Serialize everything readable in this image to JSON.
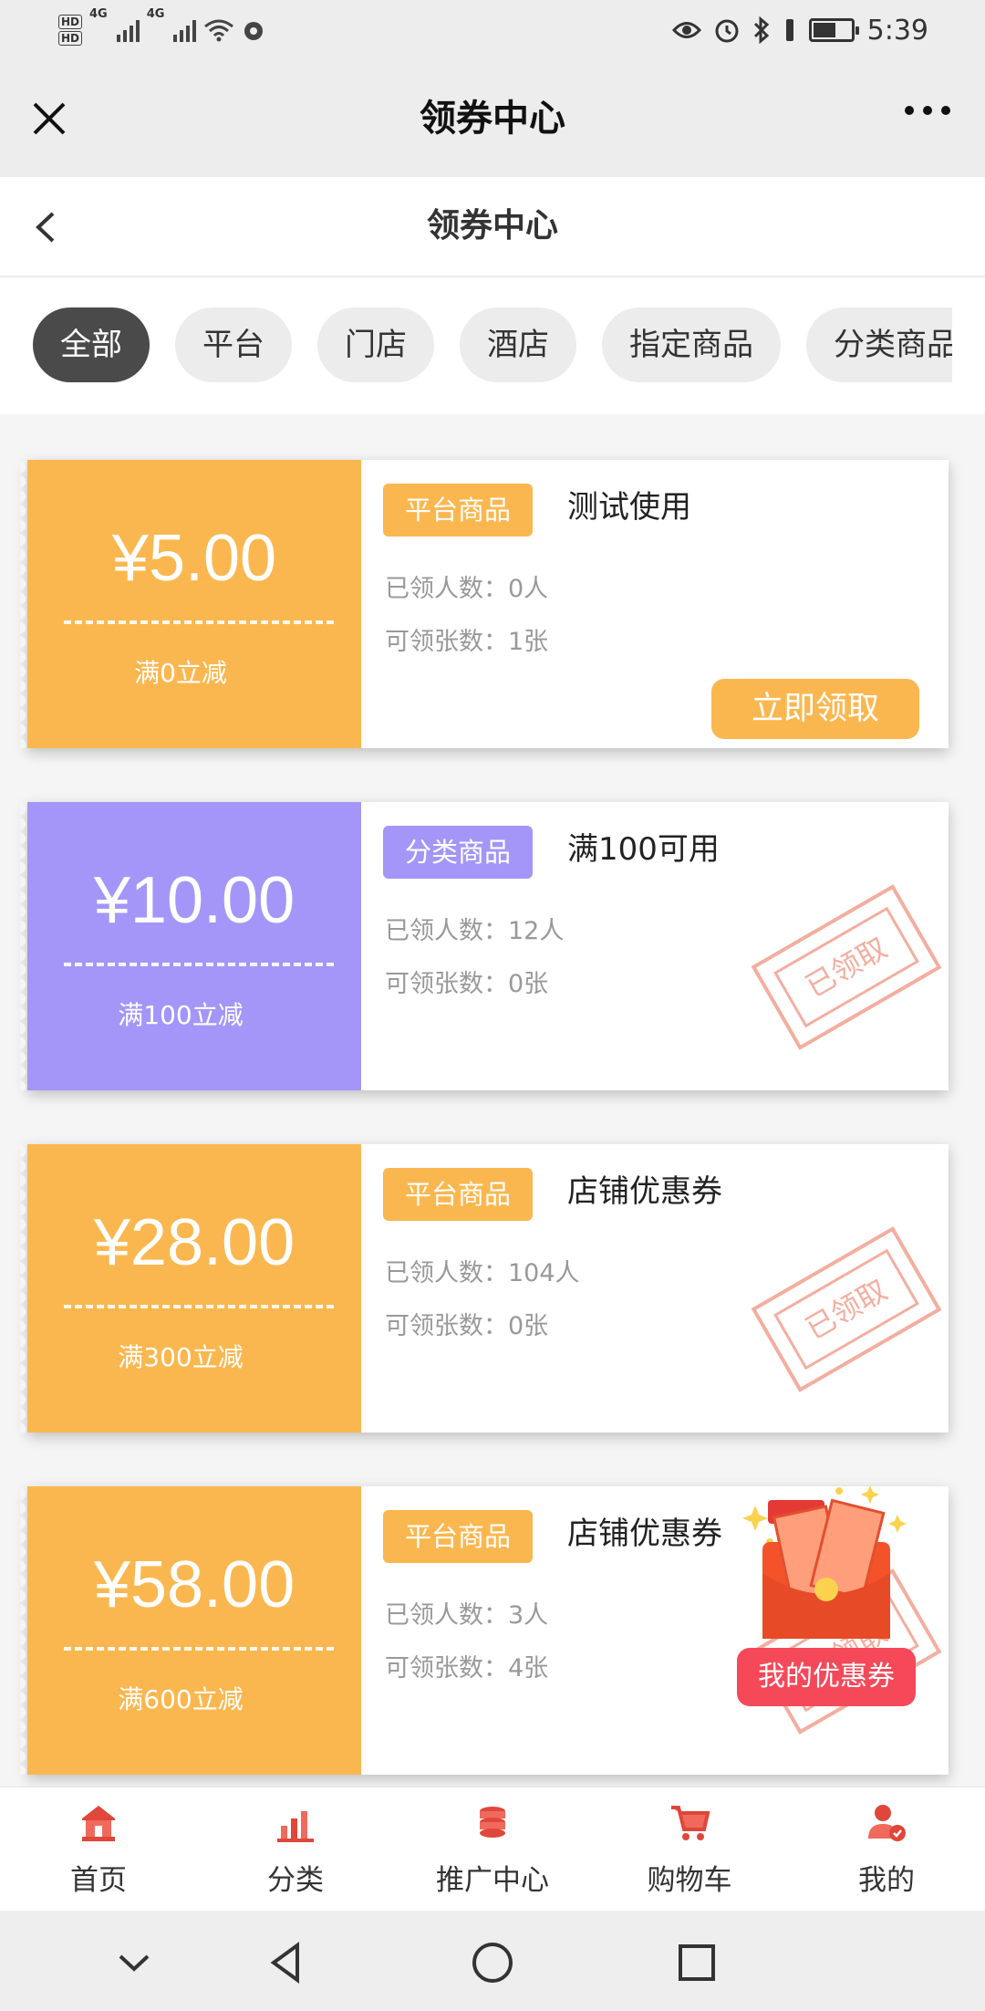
{
  "status_bar": {
    "hd_badges": [
      "HD",
      "HD"
    ],
    "signal_label_1": "4G",
    "signal_label_2": "4G",
    "time": "5:39",
    "icons": [
      "eye-icon",
      "alarm-icon",
      "bluetooth-icon",
      "vibrate-icon",
      "battery-icon"
    ]
  },
  "wechat_bar": {
    "title": "领券中心",
    "close_icon": "close-icon",
    "more_icon": "more-dots-icon"
  },
  "page_header": {
    "title": "领券中心",
    "back_icon": "back-chevron-icon"
  },
  "tabs": [
    "全部",
    "平台",
    "门店",
    "酒店",
    "指定商品",
    "分类商品"
  ],
  "active_tab_index": 0,
  "colors": {
    "orange": "#fbb74f",
    "purple": "#a496f8",
    "stamp": "#f1a08f",
    "badge": "#f5495a"
  },
  "coupons": [
    {
      "amount": "¥5.00",
      "condition": "满0立减",
      "tag": "平台商品",
      "name": "测试使用",
      "received": "已领人数：0人",
      "available": "可领张数：1张",
      "action": "立即领取",
      "theme": "orange"
    },
    {
      "amount": "¥10.00",
      "condition": "满100立减",
      "tag": "分类商品",
      "name": "满100可用",
      "received": "已领人数：12人",
      "available": "可领张数：0张",
      "stamp": "已领取",
      "theme": "purple"
    },
    {
      "amount": "¥28.00",
      "condition": "满300立减",
      "tag": "平台商品",
      "name": "店铺优惠券",
      "received": "已领人数：104人",
      "available": "可领张数：0张",
      "stamp": "已领取",
      "theme": "orange"
    },
    {
      "amount": "¥58.00",
      "condition": "满600立减",
      "tag": "平台商品",
      "name": "店铺优惠券",
      "received": "已领人数：3人",
      "available": "可领张数：4张",
      "stamp": "已领取",
      "theme": "orange"
    }
  ],
  "float_badge": {
    "label": "我的优惠券",
    "icon": "red-envelope-icon"
  },
  "tabbar": [
    {
      "label": "首页",
      "icon": "home-icon"
    },
    {
      "label": "分类",
      "icon": "category-icon"
    },
    {
      "label": "推广中心",
      "icon": "promotion-icon"
    },
    {
      "label": "购物车",
      "icon": "cart-icon"
    },
    {
      "label": "我的",
      "icon": "profile-icon"
    }
  ],
  "system_nav": [
    "collapse-chevron-icon",
    "back-triangle-icon",
    "home-circle-icon",
    "recents-square-icon"
  ]
}
